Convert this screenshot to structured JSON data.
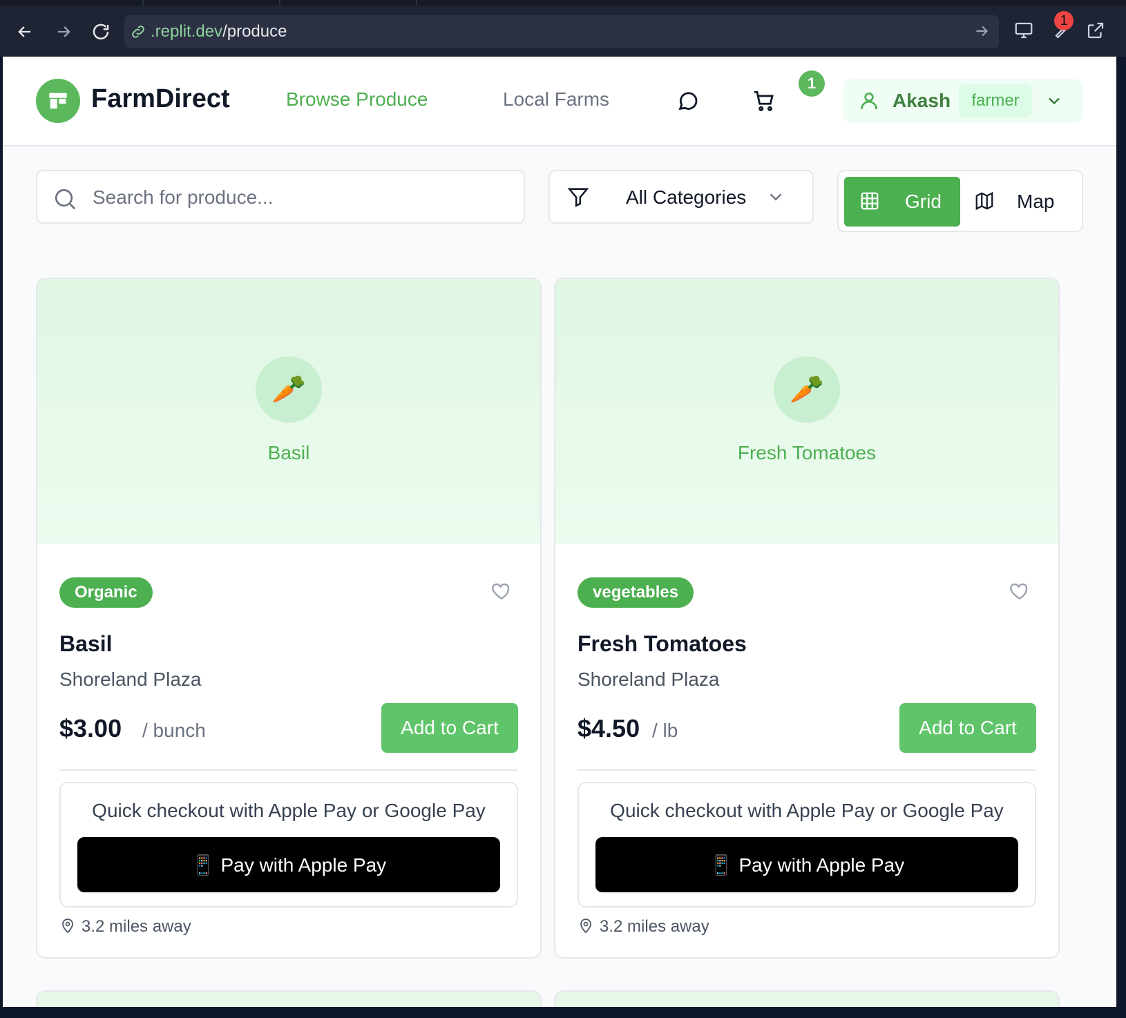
{
  "browser": {
    "url_host": ".replit.dev",
    "url_path": "/produce",
    "notification_count": "1"
  },
  "header": {
    "brand": "FarmDirect",
    "nav": [
      {
        "label": "Browse Produce",
        "active": true
      },
      {
        "label": "Local Farms",
        "active": false
      }
    ],
    "cart_count": "1",
    "user": {
      "name": "Akash",
      "role": "farmer"
    }
  },
  "toolbar": {
    "search_placeholder": "Search for produce...",
    "category_selected": "All Categories",
    "view_grid_label": "Grid",
    "view_map_label": "Map",
    "active_view": "Grid"
  },
  "products": [
    {
      "hero_label": "Basil",
      "hero_emoji": "🥕",
      "tag": "Organic",
      "title": "Basil",
      "farm": "Shoreland Plaza",
      "price": "$3.00",
      "unit": "/ bunch",
      "add_label": "Add to Cart",
      "checkout_text": "Quick checkout with Apple Pay or Google Pay",
      "pay_label": "📱 Pay with Apple Pay",
      "distance": "3.2 miles away"
    },
    {
      "hero_label": "Fresh Tomatoes",
      "hero_emoji": "🥕",
      "tag": "vegetables",
      "title": "Fresh Tomatoes",
      "farm": "Shoreland Plaza",
      "price": "$4.50",
      "unit": "/ lb",
      "add_label": "Add to Cart",
      "checkout_text": "Quick checkout with Apple Pay or Google Pay",
      "pay_label": "📱 Pay with Apple Pay",
      "distance": "3.2 miles away"
    }
  ],
  "colors": {
    "brand_green": "#4caf50",
    "button_green": "#5fc46a",
    "hero_bg": "#e0f7e4",
    "apple_pay_bg": "#000000"
  }
}
